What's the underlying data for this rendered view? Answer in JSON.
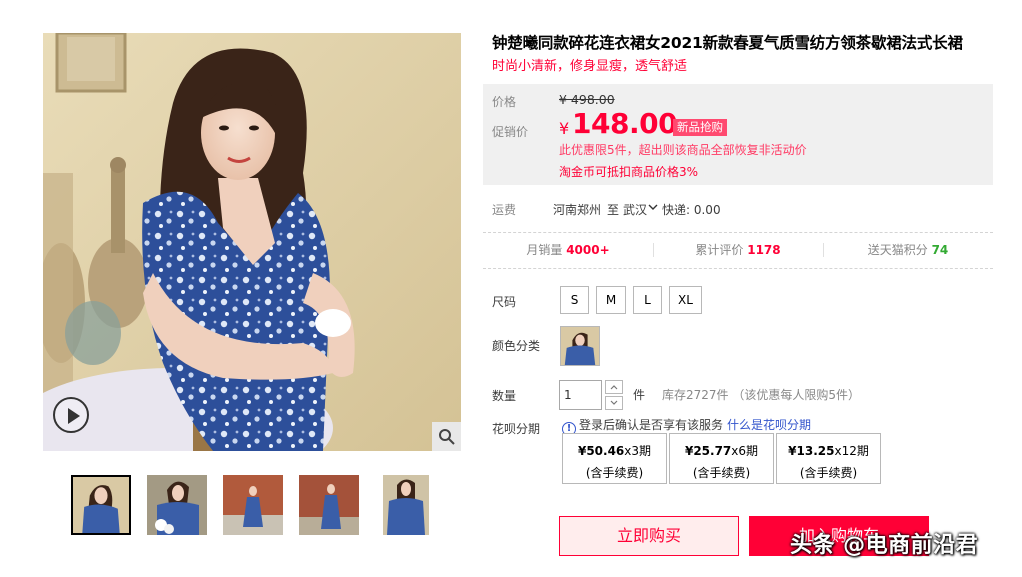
{
  "product": {
    "title": "钟楚曦同款碎花连衣裙女2021新款春夏气质雪纺方领茶歇裙法式长裙",
    "subtitle": "时尚小清新，修身显瘦，透气舒适"
  },
  "price": {
    "label": "价格",
    "original": "¥ 498.00",
    "promo_label": "促销价",
    "currency": "¥",
    "promo_value": "148.00",
    "promo_tag": "新品抢购",
    "promo_note": "此优惠限5件，超出则该商品全部恢复非活动价",
    "coin_note": "淘金币可抵扣商品价格3%"
  },
  "shipping": {
    "label": "运费",
    "from": "河南郑州",
    "to_word": "至",
    "city": "武汉",
    "fee": "快递: 0.00"
  },
  "stats": [
    {
      "label": "月销量",
      "value": "4000+"
    },
    {
      "label": "累计评价",
      "value": "1178"
    },
    {
      "label": "送天猫积分",
      "value": "74"
    }
  ],
  "size": {
    "label": "尺码",
    "options": [
      "S",
      "M",
      "L",
      "XL"
    ]
  },
  "color": {
    "label": "颜色分类"
  },
  "quantity": {
    "label": "数量",
    "value": "1",
    "unit": "件",
    "stock": "库存2727件 （该优惠每人限购5件）"
  },
  "huabei": {
    "label": "花呗分期",
    "notice_icon": "!",
    "notice": "登录后确认是否享有该服务",
    "link": "什么是花呗分期",
    "options": [
      {
        "amount": "¥50.46",
        "period": "x3期",
        "fee": "(含手续费)"
      },
      {
        "amount": "¥25.77",
        "period": "x6期",
        "fee": "(含手续费)"
      },
      {
        "amount": "¥13.25",
        "period": "x12期",
        "fee": "(含手续费)"
      }
    ]
  },
  "actions": {
    "buy_now": "立即购买",
    "add_cart": "加入购物车"
  },
  "watermark": "头条 @电商前沿君",
  "icons": {
    "play": "play-icon",
    "zoom": "magnifier-icon",
    "chevron": "chevron-down-icon",
    "info": "info-icon"
  },
  "colors": {
    "accent": "#ff0036",
    "promo_tag": "#ff4a70",
    "link": "#3355cc",
    "green": "#33aa33"
  }
}
